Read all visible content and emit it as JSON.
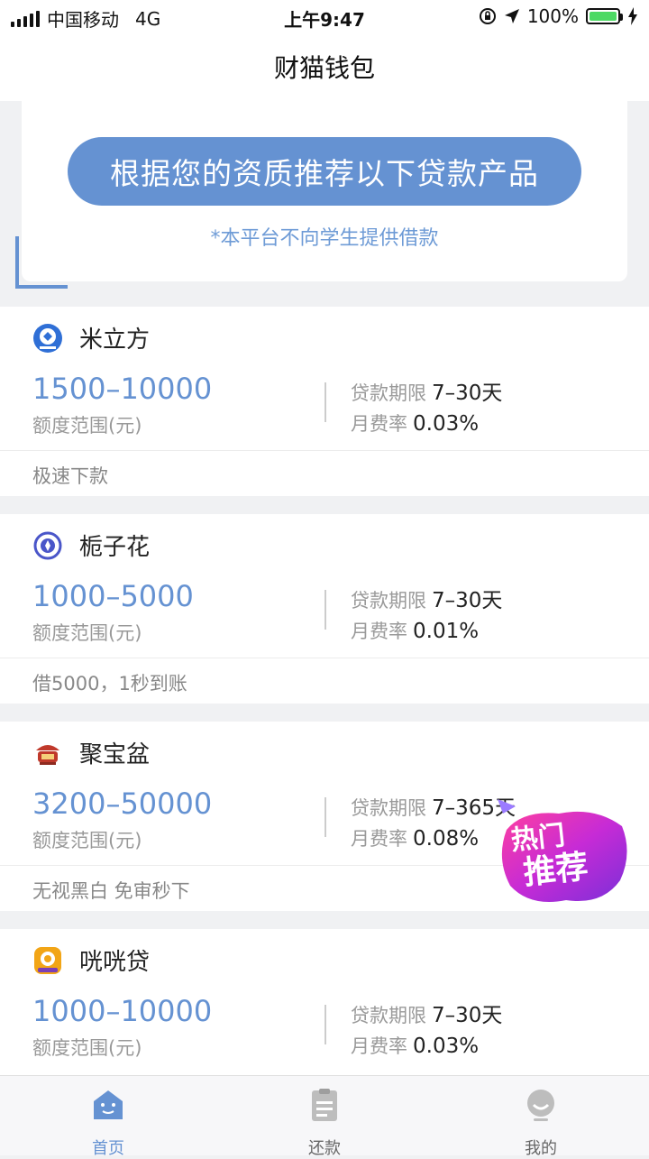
{
  "status_bar": {
    "carrier": "中国移动",
    "network": "4G",
    "time": "上午9:47",
    "battery": "100%"
  },
  "nav": {
    "title": "财猫钱包"
  },
  "recommend": {
    "headline": "根据您的资质推荐以下贷款产品",
    "note": "*本平台不向学生提供借款"
  },
  "labels": {
    "amount": "额度范围(元)",
    "term": "贷款期限",
    "rate": "月费率"
  },
  "products": [
    {
      "name": "米立方",
      "amount": "1500–10000",
      "term": "7–30天",
      "rate": "0.03%",
      "tag": "极速下款"
    },
    {
      "name": "栀子花",
      "amount": "1000–5000",
      "term": "7–30天",
      "rate": "0.01%",
      "tag": "借5000，1秒到账"
    },
    {
      "name": "聚宝盆",
      "amount": "3200–50000",
      "term": "7–365天",
      "rate": "0.08%",
      "tag": "无视黑白 免审秒下"
    },
    {
      "name": "咣咣贷",
      "amount": "1000–10000",
      "term": "7–30天",
      "rate": "0.03%",
      "tag": ""
    }
  ],
  "hot_badge": {
    "line1": "热门",
    "line2": "推荐"
  },
  "tabs": [
    {
      "label": "首页",
      "icon": "home-icon",
      "active": true
    },
    {
      "label": "还款",
      "icon": "repay-icon",
      "active": false
    },
    {
      "label": "我的",
      "icon": "profile-icon",
      "active": false
    }
  ],
  "colors": {
    "accent": "#6592d2",
    "battery": "#4cd964",
    "badge": "#c62bd6"
  }
}
